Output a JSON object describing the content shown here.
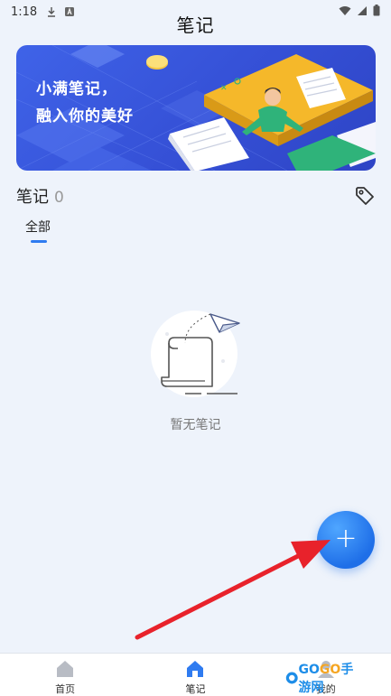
{
  "status_bar": {
    "time": "1:18"
  },
  "header": {
    "title": "笔记"
  },
  "banner": {
    "line1": "小满笔记，",
    "line2": "融入你的美好"
  },
  "notes": {
    "label": "笔记",
    "count": "0"
  },
  "tabs": [
    {
      "label": "全部",
      "active": true
    }
  ],
  "empty_state": {
    "text": "暂无笔记"
  },
  "fab": {
    "symbol": "+",
    "icon": "plus-icon"
  },
  "bottom_nav": [
    {
      "label": "首页",
      "icon": "home-icon",
      "active": false
    },
    {
      "label": "笔记",
      "icon": "home-icon",
      "active": true
    },
    {
      "label": "我的",
      "icon": "person-icon",
      "active": false
    }
  ],
  "watermark": {
    "text_a": "GO",
    "text_b": "GO",
    "text_c": "手游网"
  },
  "colors": {
    "accent": "#2f7bf0",
    "arrow": "#e8222b",
    "banner": "#3f63e8"
  }
}
